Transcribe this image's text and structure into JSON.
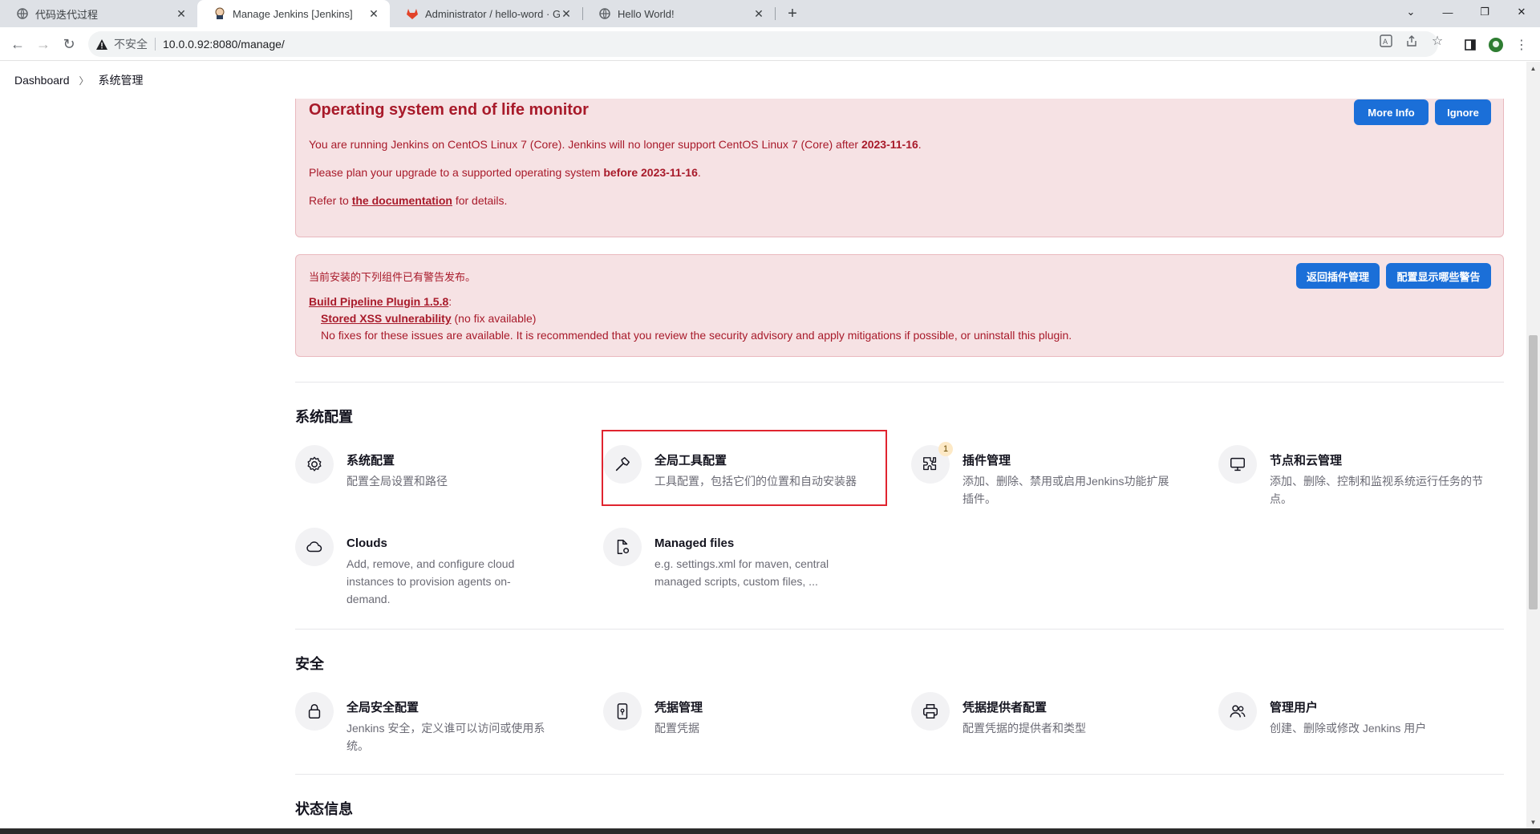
{
  "browser": {
    "tabs": [
      {
        "title": "代码迭代过程",
        "icon": "globe-icon"
      },
      {
        "title": "Manage Jenkins [Jenkins]",
        "icon": "jenkins-icon",
        "active": true
      },
      {
        "title": "Administrator / hello-word · G",
        "icon": "gitlab-icon"
      },
      {
        "title": "Hello World!",
        "icon": "globe-icon"
      }
    ],
    "new_tab": "+",
    "security_label": "不安全",
    "url": "10.0.0.92:8080/manage/"
  },
  "breadcrumb": {
    "root": "Dashboard",
    "current": "系统管理"
  },
  "eol_alert": {
    "title": "Operating system end of life monitor",
    "line1_pre": "You are running Jenkins on CentOS Linux 7 (Core). Jenkins will no longer support CentOS Linux 7 (Core) after ",
    "line1_date": "2023-11-16",
    "line1_post": ".",
    "line2_pre": "Please plan your upgrade to a supported operating system ",
    "line2_bold": "before 2023-11-16",
    "line2_post": ".",
    "line3_pre": "Refer to ",
    "line3_link": "the documentation",
    "line3_post": " for details.",
    "more_info": "More Info",
    "ignore": "Ignore"
  },
  "plugin_alert": {
    "intro": "当前安装的下列组件已有警告发布。",
    "plugin_link": "Build Pipeline Plugin 1.5.8",
    "colon": ":",
    "vuln_link": "Stored XSS vulnerability",
    "vuln_note": " (no fix available)",
    "advice": "No fixes for these issues are available. It is recommended that you review the security advisory and apply mitigations if possible, or uninstall this plugin.",
    "btn_plugins": "返回插件管理",
    "btn_configure": "配置显示哪些警告"
  },
  "sections": {
    "system": {
      "title": "系统配置",
      "items": [
        {
          "title": "系统配置",
          "desc": "配置全局设置和路径",
          "icon": "gear-icon"
        },
        {
          "title": "全局工具配置",
          "desc": "工具配置，包括它们的位置和自动安装器",
          "icon": "hammer-icon"
        },
        {
          "title": "插件管理",
          "desc": "添加、删除、禁用或启用Jenkins功能扩展插件。",
          "icon": "puzzle-icon",
          "badge": "1"
        },
        {
          "title": "节点和云管理",
          "desc": "添加、删除、控制和监视系统运行任务的节点。",
          "icon": "monitor-icon"
        },
        {
          "title": "Clouds",
          "desc": "Add, remove, and configure cloud instances to provision agents on-demand.",
          "icon": "cloud-icon"
        },
        {
          "title": "Managed files",
          "desc": "e.g. settings.xml for maven, central managed scripts, custom files, ...",
          "icon": "file-gear-icon"
        }
      ]
    },
    "security": {
      "title": "安全",
      "items": [
        {
          "title": "全局安全配置",
          "desc": "Jenkins 安全，定义谁可以访问或使用系统。",
          "icon": "lock-icon"
        },
        {
          "title": "凭据管理",
          "desc": "配置凭据",
          "icon": "phone-credentials-icon"
        },
        {
          "title": "凭据提供者配置",
          "desc": "配置凭据的提供者和类型",
          "icon": "printer-icon"
        },
        {
          "title": "管理用户",
          "desc": "创建、删除或修改 Jenkins 用户",
          "icon": "users-icon"
        }
      ]
    },
    "status": {
      "title": "状态信息"
    }
  },
  "colors": {
    "alert_bg": "#f6e2e4",
    "alert_text": "#a81a2a",
    "button_blue": "#1b6fd8",
    "highlight_box": "#e0242f"
  }
}
